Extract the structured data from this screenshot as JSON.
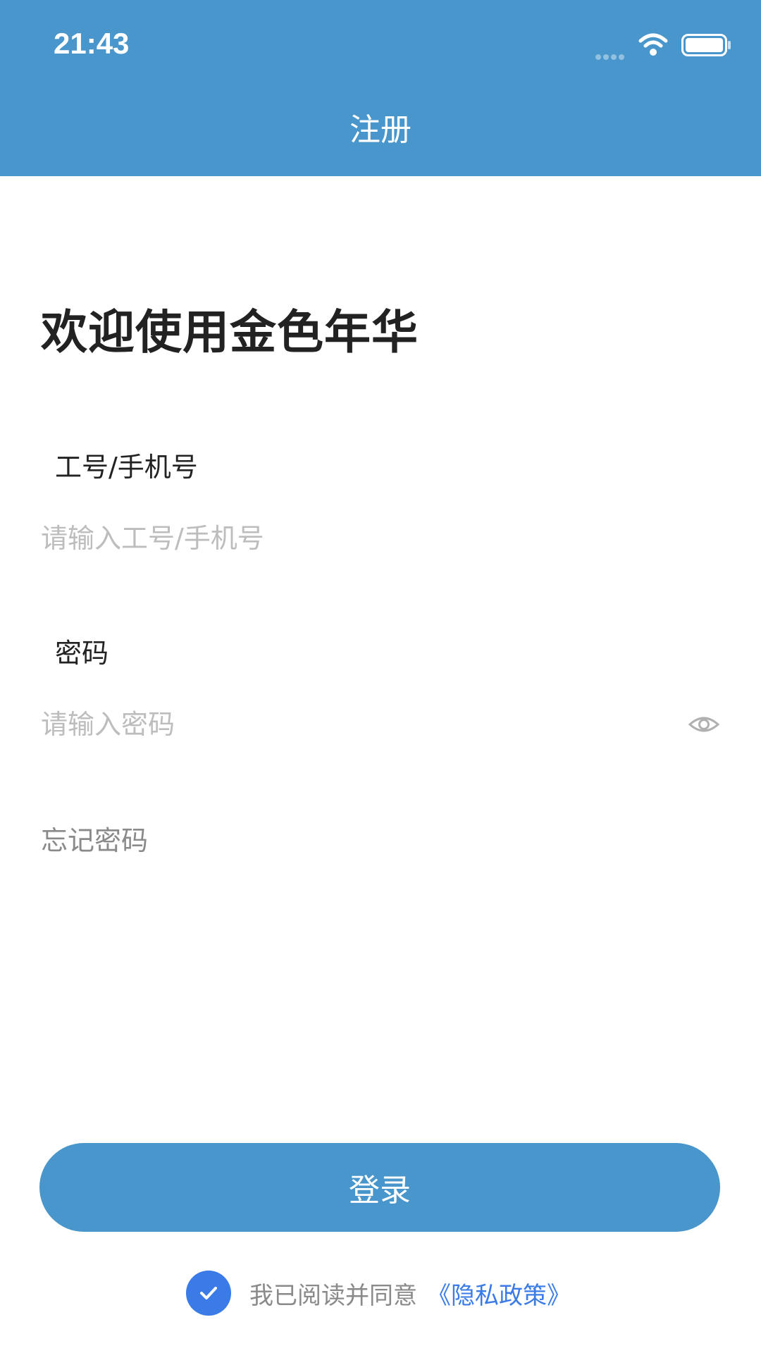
{
  "status_bar": {
    "time": "21:43",
    "icons": [
      "signal-dots-icon",
      "wifi-icon",
      "battery-icon"
    ]
  },
  "header": {
    "title": "注册"
  },
  "welcome": {
    "title": "欢迎使用金色年华"
  },
  "form": {
    "account": {
      "label": "工号/手机号",
      "placeholder": "请输入工号/手机号",
      "value": ""
    },
    "password": {
      "label": "密码",
      "placeholder": "请输入密码",
      "value": "",
      "toggle_icon": "eye-icon"
    },
    "forgot_password": "忘记密码"
  },
  "actions": {
    "login_label": "登录"
  },
  "agreement": {
    "checked": true,
    "text": "我已阅读并同意",
    "link_label": "《隐私政策》"
  },
  "colors": {
    "header_bg": "#4896cc",
    "button_bg": "#4896cc",
    "checkbox": "#3a7be8",
    "link": "#3a7be8",
    "placeholder": "#bdbdbd",
    "muted_text": "#8a8a8a"
  }
}
